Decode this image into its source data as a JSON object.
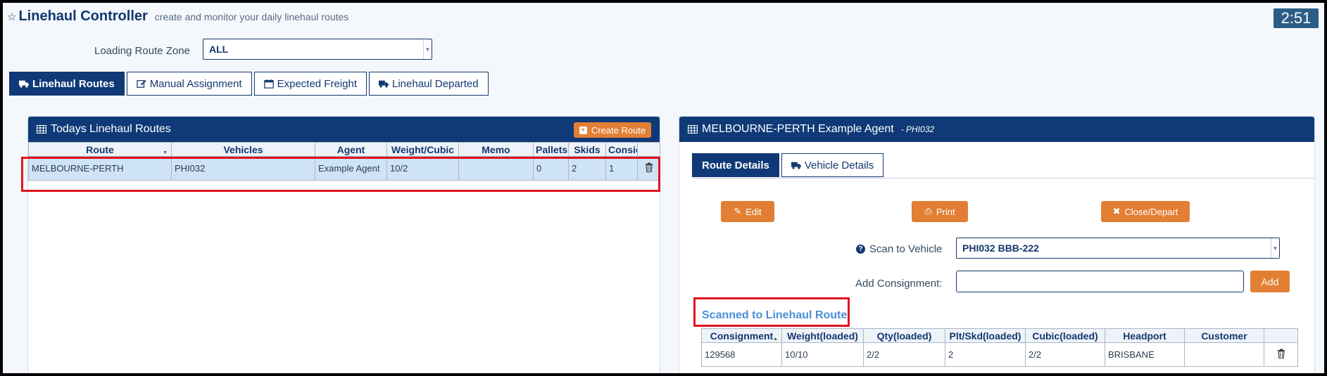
{
  "header": {
    "title": "Linehaul Controller",
    "subtitle": "create and monitor your daily linehaul routes",
    "clock": "2:51"
  },
  "zone": {
    "label": "Loading Route Zone",
    "value": "ALL"
  },
  "tabs": [
    {
      "label": "Linehaul Routes",
      "icon": "truck-icon"
    },
    {
      "label": "Manual Assignment",
      "icon": "edit-icon"
    },
    {
      "label": "Expected Freight",
      "icon": "calendar-icon"
    },
    {
      "label": "Linehaul Departed",
      "icon": "truck-icon"
    }
  ],
  "routes_panel": {
    "title": "Todays Linehaul Routes",
    "create_button": "Create Route",
    "columns": [
      "Route",
      "Vehicles",
      "Agent",
      "Weight/Cubic",
      "Memo",
      "Pallets",
      "Skids",
      "Consic"
    ],
    "rows": [
      {
        "route": "MELBOURNE-PERTH",
        "vehicles": "PHI032",
        "agent": "Example Agent",
        "weight_cubic": "10/2",
        "memo": "",
        "pallets": "0",
        "skids": "2",
        "consignments": "1"
      }
    ]
  },
  "detail_panel": {
    "title": "MELBOURNE-PERTH Example Agent",
    "code": "- PHI032",
    "subtabs": [
      "Route Details",
      "Vehicle Details"
    ],
    "buttons": {
      "edit": "Edit",
      "print": "Print",
      "close": "Close/Depart"
    },
    "scan_label": "Scan to Vehicle",
    "scan_value": "PHI032 BBB-222",
    "add_label": "Add Consignment:",
    "add_value": "",
    "add_button": "Add",
    "scanned_title": "Scanned to Linehaul Route",
    "columns": [
      "Consignment",
      "Weight(loaded)",
      "Qty(loaded)",
      "Plt/Skd(loaded)",
      "Cubic(loaded)",
      "Headport",
      "Customer"
    ],
    "rows": [
      {
        "consignment": "129568",
        "weight": "10/10",
        "qty": "2/2",
        "plt_skd": "2",
        "cubic": "2/2",
        "headport": "BRISBANE",
        "customer": ""
      }
    ]
  },
  "colors": {
    "primary": "#0f3a77",
    "accent": "#e27f35",
    "highlight": "#e0141e",
    "row_selected": "#cfe3f6"
  }
}
